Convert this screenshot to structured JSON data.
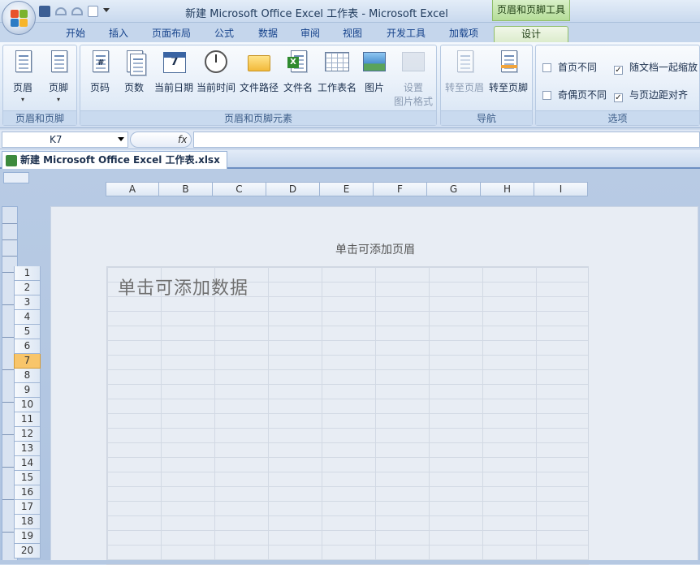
{
  "title": {
    "window": "新建 Microsoft Office Excel 工作表 - Microsoft Excel",
    "context_tools": "页眉和页脚工具"
  },
  "tabs": [
    "开始",
    "插入",
    "页面布局",
    "公式",
    "数据",
    "审阅",
    "视图",
    "开发工具",
    "加载项",
    "设计"
  ],
  "active_tab": "设计",
  "ribbon": {
    "groups": {
      "header_footer": {
        "label": "页眉和页脚",
        "buttons": [
          "页眉",
          "页脚"
        ]
      },
      "elements": {
        "label": "页眉和页脚元素",
        "buttons": [
          "页码",
          "页数",
          "当前日期",
          "当前时间",
          "文件路径",
          "文件名",
          "工作表名",
          "图片",
          "设置",
          "图片格式"
        ]
      },
      "navigation": {
        "label": "导航",
        "buttons": [
          "转至页眉",
          "转至页脚"
        ]
      },
      "options": {
        "label": "选项",
        "checkboxes": [
          {
            "label": "首页不同",
            "checked": false
          },
          {
            "label": "随文档一起缩放",
            "checked": true
          },
          {
            "label": "奇偶页不同",
            "checked": false
          },
          {
            "label": "与页边距对齐",
            "checked": true
          }
        ]
      }
    }
  },
  "formula_bar": {
    "name_box": "K7",
    "fx": "fx",
    "value": ""
  },
  "document_tab": "新建 Microsoft Office Excel 工作表.xlsx",
  "columns": [
    "A",
    "B",
    "C",
    "D",
    "E",
    "F",
    "G",
    "H",
    "I"
  ],
  "rows": [
    "1",
    "2",
    "3",
    "4",
    "5",
    "6",
    "7",
    "8",
    "9",
    "10",
    "11",
    "12",
    "13",
    "14",
    "15",
    "16",
    "17",
    "18",
    "19",
    "20"
  ],
  "selected_row": "7",
  "page": {
    "header_hint": "单击可添加页眉",
    "data_hint": "单击可添加数据"
  },
  "colors": {
    "accent": "#15428b",
    "context": "#b5dd98",
    "selected_row": "#f8c56a"
  }
}
